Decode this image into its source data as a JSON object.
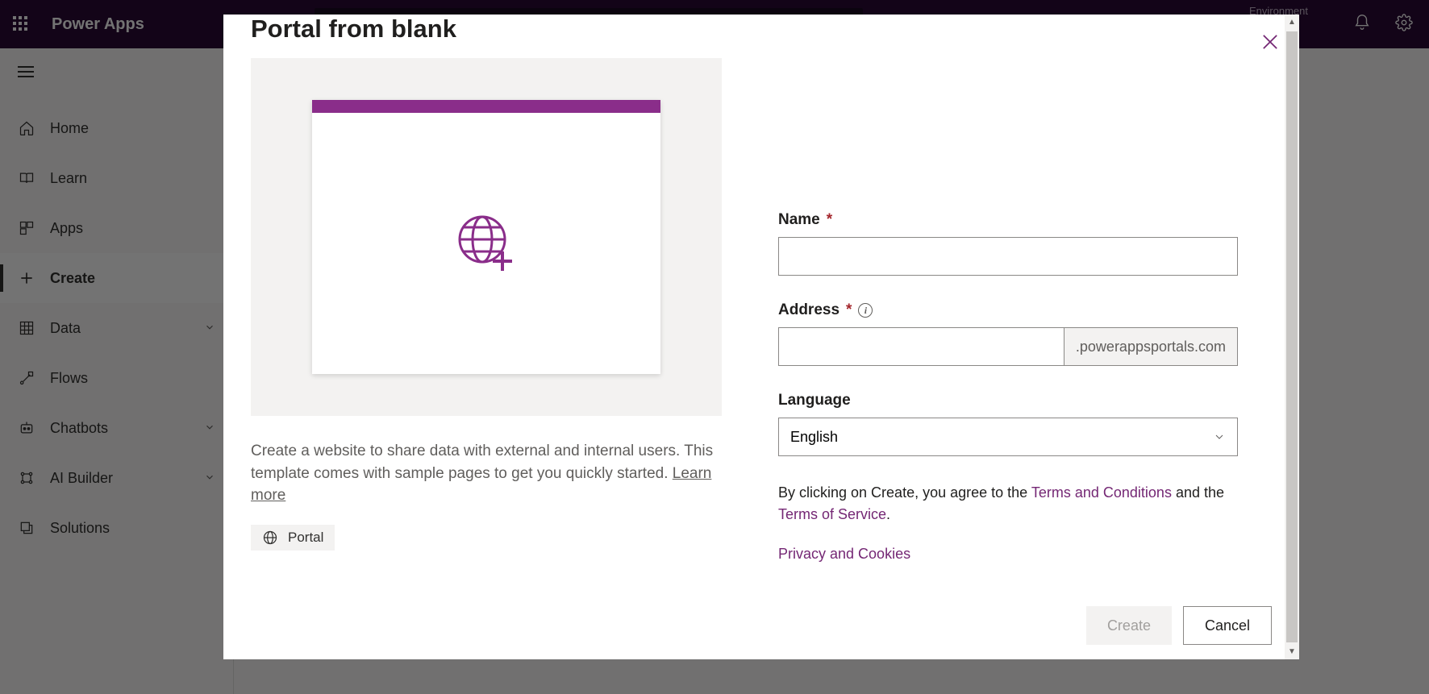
{
  "header": {
    "brand": "Power Apps",
    "environment_label": "Environment"
  },
  "sidebar": {
    "items": [
      {
        "label": "Home"
      },
      {
        "label": "Learn"
      },
      {
        "label": "Apps"
      },
      {
        "label": "Create"
      },
      {
        "label": "Data"
      },
      {
        "label": "Flows"
      },
      {
        "label": "Chatbots"
      },
      {
        "label": "AI Builder"
      },
      {
        "label": "Solutions"
      }
    ]
  },
  "modal": {
    "title": "Portal from blank",
    "description": "Create a website to share data with external and internal users. This template comes with sample pages to get you quickly started. ",
    "learn_more": "Learn more",
    "tag": "Portal",
    "form": {
      "name_label": "Name",
      "name_value": "",
      "address_label": "Address",
      "address_value": "",
      "address_suffix": ".powerappsportals.com",
      "language_label": "Language",
      "language_value": "English"
    },
    "legal": {
      "prefix": "By clicking on Create, you agree to the ",
      "terms_conditions": "Terms and Conditions",
      "middle": " and the ",
      "terms_service": "Terms of Service",
      "suffix": ".",
      "privacy": "Privacy and Cookies"
    },
    "buttons": {
      "create": "Create",
      "cancel": "Cancel"
    }
  }
}
